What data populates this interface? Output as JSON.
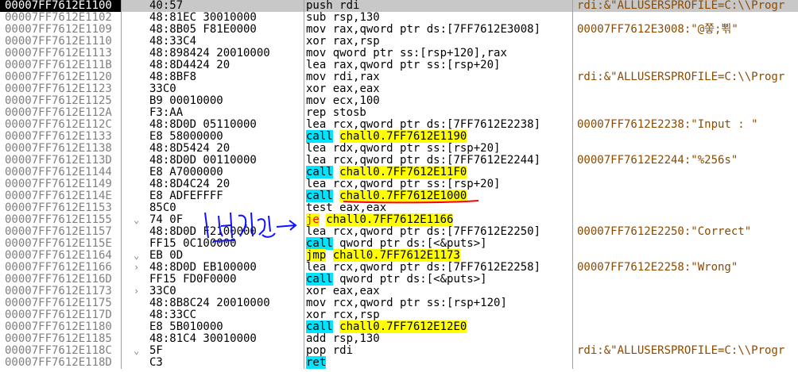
{
  "rows": [
    {
      "addr": "00007FF7612E1100",
      "bytes": "40:57",
      "mn": "push",
      "ops": "rdi",
      "hl": "none",
      "comment": "rdi:&\"ALLUSERSPROFILE=C:\\\\Progr",
      "selected": true
    },
    {
      "addr": "00007FF7612E1102",
      "bytes": "48:81EC 30010000",
      "mn": "sub",
      "ops": "rsp,130",
      "hl": "none",
      "comment": ""
    },
    {
      "addr": "00007FF7612E1109",
      "bytes": "48:8B05 F81E0000",
      "mn": "mov",
      "ops": "rax,qword ptr ds:[7FF7612E3008]",
      "hl": "none",
      "comment": "00007FF7612E3008:\"@쫗;뾖\""
    },
    {
      "addr": "00007FF7612E1110",
      "bytes": "48:33C4",
      "mn": "xor",
      "ops": "rax,rsp",
      "hl": "none",
      "comment": ""
    },
    {
      "addr": "00007FF7612E1113",
      "bytes": "48:898424 20010000",
      "mn": "mov",
      "ops": "qword ptr ss:[rsp+120],rax",
      "hl": "none",
      "comment": ""
    },
    {
      "addr": "00007FF7612E111B",
      "bytes": "48:8D4424 20",
      "mn": "lea",
      "ops": "rax,qword ptr ss:[rsp+20]",
      "hl": "none",
      "comment": ""
    },
    {
      "addr": "00007FF7612E1120",
      "bytes": "48:8BF8",
      "mn": "mov",
      "ops": "rdi,rax",
      "hl": "none",
      "comment": "rdi:&\"ALLUSERSPROFILE=C:\\\\Progr"
    },
    {
      "addr": "00007FF7612E1123",
      "bytes": "33C0",
      "mn": "xor",
      "ops": "eax,eax",
      "hl": "none",
      "comment": ""
    },
    {
      "addr": "00007FF7612E1125",
      "bytes": "B9 00010000",
      "mn": "mov",
      "ops": "ecx,100",
      "hl": "none",
      "comment": ""
    },
    {
      "addr": "00007FF7612E112A",
      "bytes": "F3:AA",
      "mn": "rep stosb",
      "ops": "",
      "hl": "none",
      "comment": ""
    },
    {
      "addr": "00007FF7612E112C",
      "bytes": "48:8D0D 05110000",
      "mn": "lea",
      "ops": "rcx,qword ptr ds:[7FF7612E2238]",
      "hl": "none",
      "comment": "00007FF7612E2238:\"Input : \""
    },
    {
      "addr": "00007FF7612E1133",
      "bytes": "E8 58000000",
      "mn": "call",
      "ops": "chall0.7FF7612E1190",
      "hl": "call",
      "comment": ""
    },
    {
      "addr": "00007FF7612E1138",
      "bytes": "48:8D5424 20",
      "mn": "lea",
      "ops": "rdx,qword ptr ss:[rsp+20]",
      "hl": "none",
      "comment": ""
    },
    {
      "addr": "00007FF7612E113D",
      "bytes": "48:8D0D 00110000",
      "mn": "lea",
      "ops": "rcx,qword ptr ds:[7FF7612E2244]",
      "hl": "none",
      "comment": "00007FF7612E2244:\"%256s\""
    },
    {
      "addr": "00007FF7612E1144",
      "bytes": "E8 A7000000",
      "mn": "call",
      "ops": "chall0.7FF7612E11F0",
      "hl": "call",
      "comment": ""
    },
    {
      "addr": "00007FF7612E1149",
      "bytes": "48:8D4C24 20",
      "mn": "lea",
      "ops": "rcx,qword ptr ss:[rsp+20]",
      "hl": "none",
      "comment": ""
    },
    {
      "addr": "00007FF7612E114E",
      "bytes": "E8 ADFEFFFF",
      "mn": "call",
      "ops": "chall0.7FF7612E1000",
      "hl": "call",
      "comment": ""
    },
    {
      "addr": "00007FF7612E1153",
      "bytes": "85C0",
      "mn": "test",
      "ops": "eax,eax",
      "hl": "none",
      "comment": ""
    },
    {
      "addr": "00007FF7612E1155",
      "bytes": "74 0F",
      "mn": "je",
      "ops": "chall0.7FF7612E1166",
      "hl": "jcc",
      "comment": "",
      "arrow": "⌄"
    },
    {
      "addr": "00007FF7612E1157",
      "bytes": "48:8D0D F2100000",
      "mn": "lea",
      "ops": "rcx,qword ptr ds:[7FF7612E2250]",
      "hl": "none",
      "comment": "00007FF7612E2250:\"Correct\""
    },
    {
      "addr": "00007FF7612E115E",
      "bytes": "FF15 0C100000",
      "mn": "call",
      "ops": "qword ptr ds:[<&puts>]",
      "hl": "call",
      "comment": ""
    },
    {
      "addr": "00007FF7612E1164",
      "bytes": "EB 0D",
      "mn": "jmp",
      "ops": "chall0.7FF7612E1173",
      "hl": "jmp",
      "comment": "",
      "arrow": "⌄"
    },
    {
      "addr": "00007FF7612E1166",
      "bytes": "48:8D0D EB100000",
      "mn": "lea",
      "ops": "rcx,qword ptr ds:[7FF7612E2258]",
      "hl": "none",
      "comment": "00007FF7612E2258:\"Wrong\"",
      "arrow": "›"
    },
    {
      "addr": "00007FF7612E116D",
      "bytes": "FF15 FD0F0000",
      "mn": "call",
      "ops": "qword ptr ds:[<&puts>]",
      "hl": "call",
      "comment": ""
    },
    {
      "addr": "00007FF7612E1173",
      "bytes": "33C0",
      "mn": "xor",
      "ops": "eax,eax",
      "hl": "none",
      "comment": "",
      "arrow": "›"
    },
    {
      "addr": "00007FF7612E1175",
      "bytes": "48:8B8C24 20010000",
      "mn": "mov",
      "ops": "rcx,qword ptr ss:[rsp+120]",
      "hl": "none",
      "comment": ""
    },
    {
      "addr": "00007FF7612E117D",
      "bytes": "48:33CC",
      "mn": "xor",
      "ops": "rcx,rsp",
      "hl": "none",
      "comment": ""
    },
    {
      "addr": "00007FF7612E1180",
      "bytes": "E8 5B010000",
      "mn": "call",
      "ops": "chall0.7FF7612E12E0",
      "hl": "call",
      "comment": ""
    },
    {
      "addr": "00007FF7612E1185",
      "bytes": "48:81C4 30010000",
      "mn": "add",
      "ops": "rsp,130",
      "hl": "none",
      "comment": ""
    },
    {
      "addr": "00007FF7612E118C",
      "bytes": "5F",
      "mn": "pop",
      "ops": "rdi",
      "hl": "none",
      "comment": "rdi:&\"ALLUSERSPROFILE=C:\\\\Progr",
      "arrow": "⌄"
    },
    {
      "addr": "00007FF7612E118D",
      "bytes": "C3",
      "mn": "ret",
      "ops": "",
      "hl": "ret",
      "comment": ""
    }
  ],
  "annotation": {
    "text": "1 번 지점 →",
    "color": "#1010ff"
  },
  "underline_color": "#ff0000",
  "colors": {
    "selected_bg": "#000000",
    "call_hl": "#00e5ff",
    "jmp_hl": "#ffff00",
    "comment": "#8b4a00",
    "address": "#808080"
  }
}
